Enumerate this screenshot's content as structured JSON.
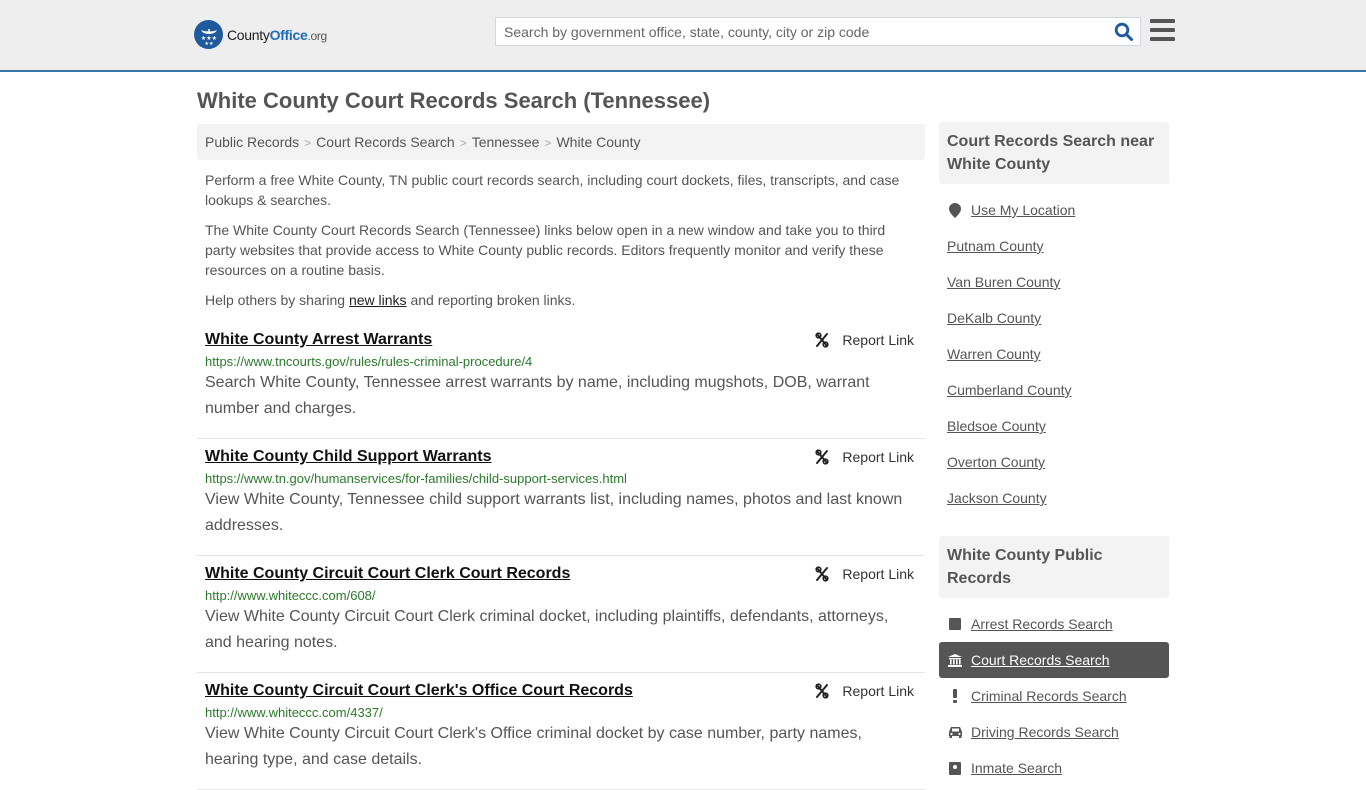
{
  "header": {
    "logo": {
      "name_part1": "County",
      "name_part2": "Office",
      "tld": ".org"
    },
    "search": {
      "placeholder": "Search by government office, state, county, city or zip code",
      "value": ""
    },
    "icons": {
      "search": "search-icon",
      "menu": "hamburger-menu-icon"
    }
  },
  "page": {
    "title": "White County Court Records Search (Tennessee)"
  },
  "breadcrumb": [
    {
      "label": "Public Records"
    },
    {
      "label": "Court Records Search"
    },
    {
      "label": "Tennessee"
    },
    {
      "label": "White County"
    }
  ],
  "breadcrumb_separator": ">",
  "intro": {
    "p1": "Perform a free White County, TN public court records search, including court dockets, files, transcripts, and case lookups & searches.",
    "p2": "The White County Court Records Search (Tennessee) links below open in a new window and take you to third party websites that provide access to White County public records. Editors frequently monitor and verify these resources on a routine basis.",
    "p3_before": "Help others by sharing ",
    "p3_link": "new links",
    "p3_after": " and reporting broken links."
  },
  "results": [
    {
      "title": "White County Arrest Warrants",
      "url": "https://www.tncourts.gov/rules/rules-criminal-procedure/4",
      "description": "Search White County, Tennessee arrest warrants by name, including mugshots, DOB, warrant number and charges.",
      "report_label": "Report Link"
    },
    {
      "title": "White County Child Support Warrants",
      "url": "https://www.tn.gov/humanservices/for-families/child-support-services.html",
      "description": "View White County, Tennessee child support warrants list, including names, photos and last known addresses.",
      "report_label": "Report Link"
    },
    {
      "title": "White County Circuit Court Clerk Court Records",
      "url": "http://www.whiteccc.com/608/",
      "description": "View White County Circuit Court Clerk criminal docket, including plaintiffs, defendants, attorneys, and hearing notes.",
      "report_label": "Report Link"
    },
    {
      "title": "White County Circuit Court Clerk's Office Court Records",
      "url": "http://www.whiteccc.com/4337/",
      "description": "View White County Circuit Court Clerk's Office criminal docket by case number, party names, hearing type, and case details.",
      "report_label": "Report Link"
    }
  ],
  "sidebar": {
    "nearby": {
      "heading": "Court Records Search near White County",
      "use_location": "Use My Location",
      "counties": [
        "Putnam County",
        "Van Buren County",
        "DeKalb County",
        "Warren County",
        "Cumberland County",
        "Bledsoe County",
        "Overton County",
        "Jackson County"
      ]
    },
    "public_records": {
      "heading": "White County Public Records",
      "items": [
        {
          "label": "Arrest Records Search",
          "icon": "square-icon",
          "active": false
        },
        {
          "label": "Court Records Search",
          "icon": "courthouse-icon",
          "active": true
        },
        {
          "label": "Criminal Records Search",
          "icon": "exclamation-icon",
          "active": false
        },
        {
          "label": "Driving Records Search",
          "icon": "car-icon",
          "active": false
        },
        {
          "label": "Inmate Search",
          "icon": "inmate-icon",
          "active": false
        }
      ]
    }
  },
  "colors": {
    "brand_blue": "#1e5a9c",
    "header_border": "#3a76a8",
    "url_green": "#2b7a2b",
    "active_item_bg": "#555555"
  }
}
